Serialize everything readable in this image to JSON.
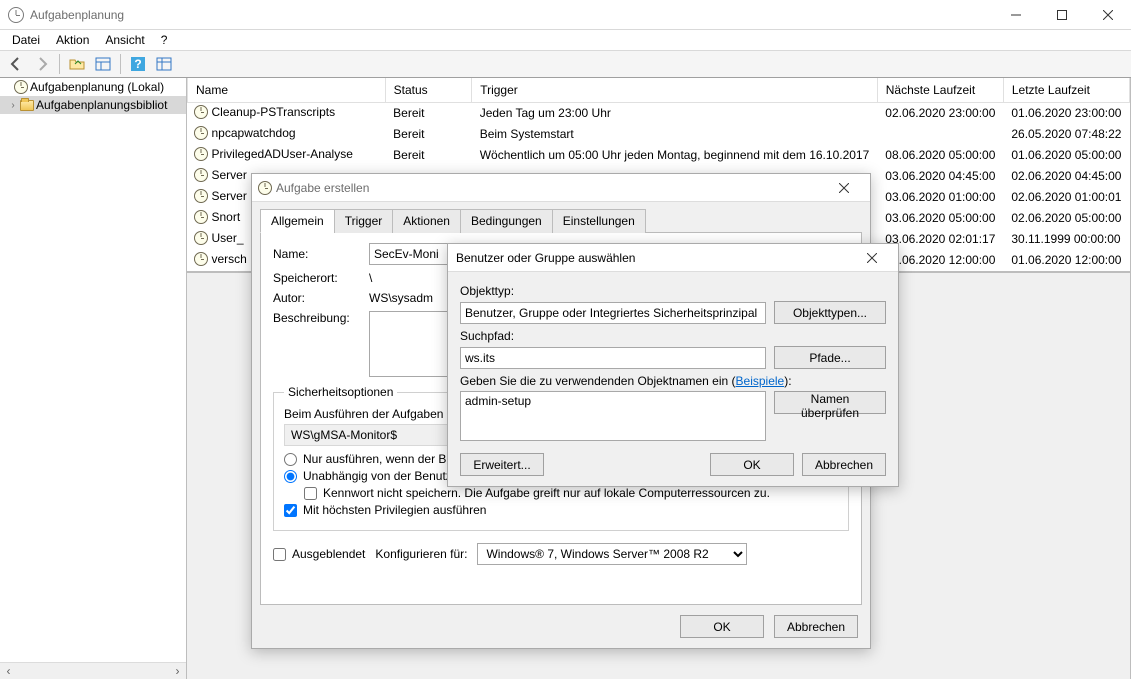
{
  "window": {
    "title": "Aufgabenplanung"
  },
  "menu": {
    "file": "Datei",
    "action": "Aktion",
    "view": "Ansicht",
    "help": "?"
  },
  "tree": {
    "root": "Aufgabenplanung (Lokal)",
    "child": "Aufgabenplanungsbibliot"
  },
  "grid": {
    "cols": {
      "name": "Name",
      "status": "Status",
      "trigger": "Trigger",
      "next": "Nächste Laufzeit",
      "last": "Letzte Laufzeit"
    },
    "rows": [
      {
        "name": "Cleanup-PSTranscripts",
        "status": "Bereit",
        "trigger": "Jeden Tag um 23:00 Uhr",
        "next": "02.06.2020 23:00:00",
        "last": "01.06.2020 23:00:00"
      },
      {
        "name": "npcapwatchdog",
        "status": "Bereit",
        "trigger": "Beim Systemstart",
        "next": "",
        "last": "26.05.2020 07:48:22"
      },
      {
        "name": "PrivilegedADUser-Analyse",
        "status": "Bereit",
        "trigger": "Wöchentlich um 05:00 Uhr jeden Montag, beginnend mit dem 16.10.2017",
        "next": "08.06.2020 05:00:00",
        "last": "01.06.2020 05:00:00"
      },
      {
        "name": "Server",
        "status": "",
        "trigger": "",
        "next": "03.06.2020 04:45:00",
        "last": "02.06.2020 04:45:00"
      },
      {
        "name": "Server",
        "status": "",
        "trigger": "",
        "next": "03.06.2020 01:00:00",
        "last": "02.06.2020 01:00:01"
      },
      {
        "name": "Snort",
        "status": "",
        "trigger": "",
        "next": "03.06.2020 05:00:00",
        "last": "02.06.2020 05:00:00"
      },
      {
        "name": "User_",
        "status": "",
        "trigger": "",
        "next": "03.06.2020 02:01:17",
        "last": "30.11.1999 00:00:00"
      },
      {
        "name": "versch",
        "status": "",
        "trigger": "",
        "next": "02.06.2020 12:00:00",
        "last": "01.06.2020 12:00:00"
      }
    ]
  },
  "dlg1": {
    "title": "Aufgabe erstellen",
    "tabs": {
      "general": "Allgemein",
      "trigger": "Trigger",
      "actions": "Aktionen",
      "conditions": "Bedingungen",
      "settings": "Einstellungen"
    },
    "labels": {
      "name": "Name:",
      "location": "Speicherort:",
      "author": "Autor:",
      "desc": "Beschreibung:"
    },
    "values": {
      "name": "SecEv-Moni",
      "location": "\\",
      "author": "WS\\sysadm"
    },
    "sec": {
      "legend": "Sicherheitsoptionen",
      "runas": "Beim Ausführen der Aufgaben",
      "account": "WS\\gMSA-Monitor$",
      "opt_loggedon": "Nur ausführen, wenn der B",
      "opt_independent": "Unabhängig von der Benutzeranmeldung ausführen",
      "opt_nopw": "Kennwort nicht speichern. Die Aufgabe greift nur auf lokale Computerressourcen zu.",
      "opt_highest": "Mit höchsten Privilegien ausführen"
    },
    "hidden": "Ausgeblendet",
    "configfor_label": "Konfigurieren für:",
    "configfor_value": "Windows® 7, Windows Server™ 2008 R2",
    "ok": "OK",
    "cancel": "Abbrechen"
  },
  "dlg2": {
    "title": "Benutzer oder Gruppe auswählen",
    "objtype_label": "Objekttyp:",
    "objtype_value": "Benutzer, Gruppe oder Integriertes Sicherheitsprinzipal",
    "objtype_btn": "Objekttypen...",
    "path_label": "Suchpfad:",
    "path_value": "ws.its",
    "path_btn": "Pfade...",
    "enter_label_pre": "Geben Sie die zu verwendenden Objektnamen ein (",
    "enter_link": "Beispiele",
    "enter_label_post": "):",
    "object_value": "admin-setup",
    "check_btn": "Namen überprüfen",
    "adv": "Erweitert...",
    "ok": "OK",
    "cancel": "Abbrechen"
  }
}
